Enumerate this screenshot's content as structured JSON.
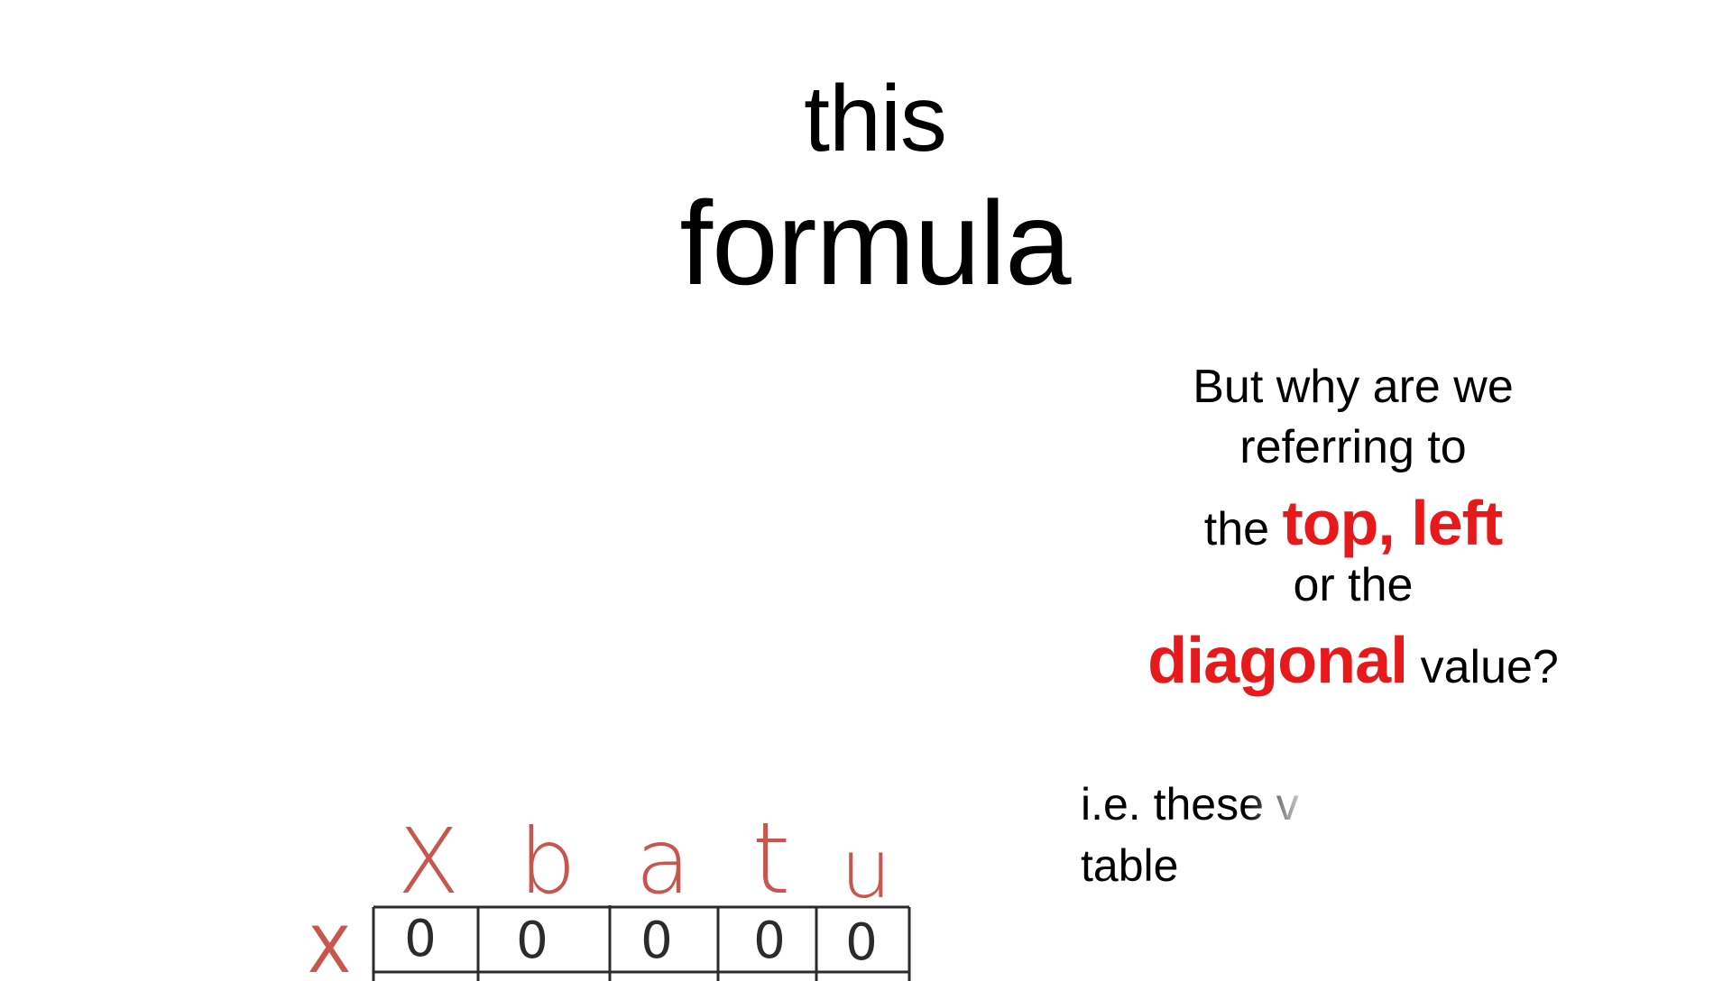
{
  "slide": {
    "title": {
      "line1": "this",
      "line2": "formula"
    },
    "question": {
      "line1": "But why are we",
      "line2": "referring to",
      "line3_prefix": "the",
      "line3_highlight": "top, left",
      "line4": "or the",
      "line5_highlight": "diagonal",
      "line5_suffix": "value?"
    },
    "note": {
      "line1": "i.e. these v",
      "line2": "table"
    },
    "handwritten_table": {
      "column_headers": [
        "X",
        "b",
        "a",
        "t",
        "u"
      ],
      "row_header": "X",
      "first_row_cells": [
        "0",
        "0",
        "0",
        "0",
        "0"
      ]
    }
  },
  "colors": {
    "highlight": "#e8191a",
    "handwriting_header": "#c8564f",
    "text": "#000000",
    "background": "#ffffff"
  }
}
